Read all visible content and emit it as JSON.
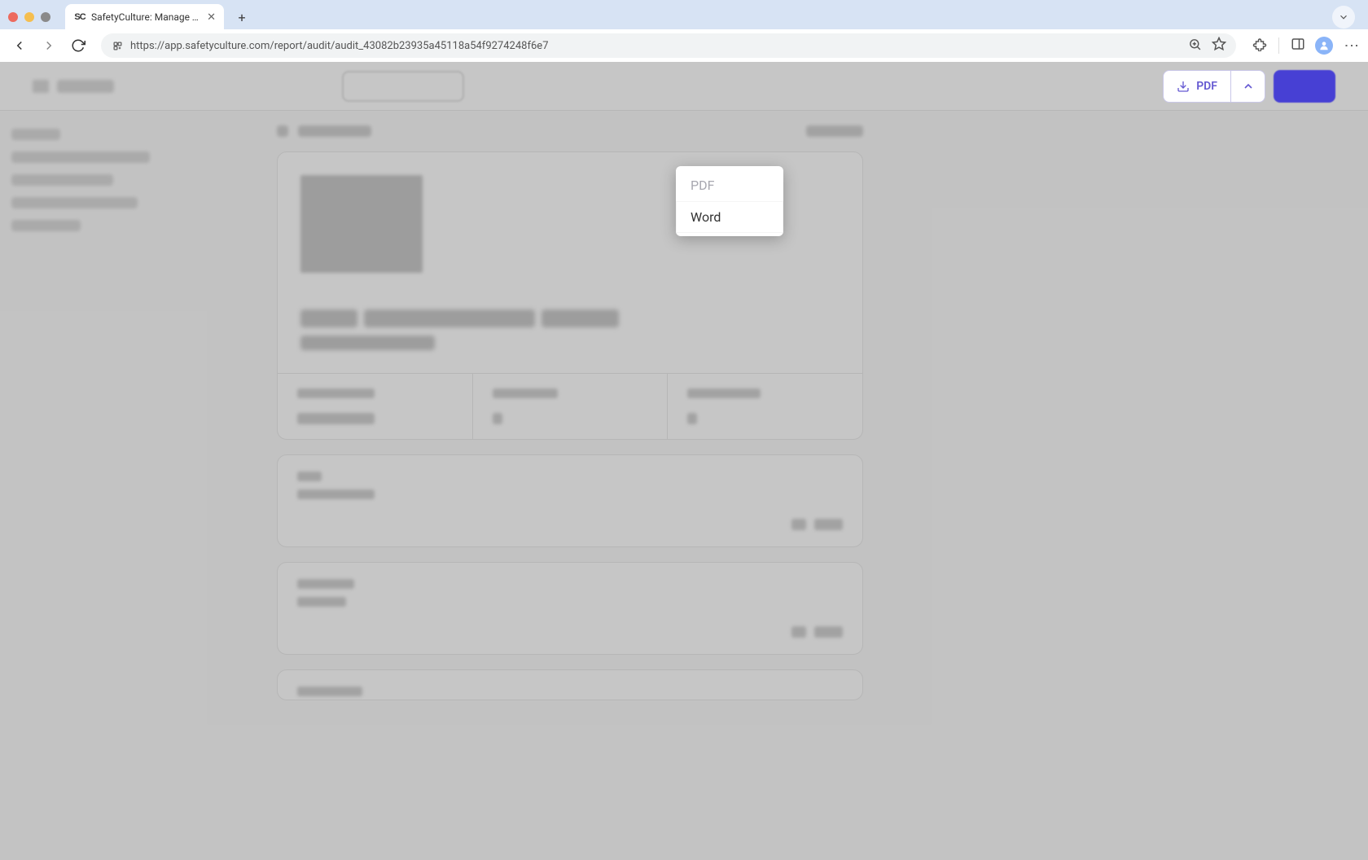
{
  "browser": {
    "tab_title": "SafetyCulture: Manage Teams and...",
    "favicon_text": "SC",
    "url": "https://app.safetyculture.com/report/audit/audit_43082b23935a45118a54f9274248f6e7"
  },
  "header": {
    "pdf_label": "PDF"
  },
  "dropdown": {
    "items": [
      {
        "label": "PDF",
        "active": false
      },
      {
        "label": "Word",
        "active": true
      }
    ]
  }
}
